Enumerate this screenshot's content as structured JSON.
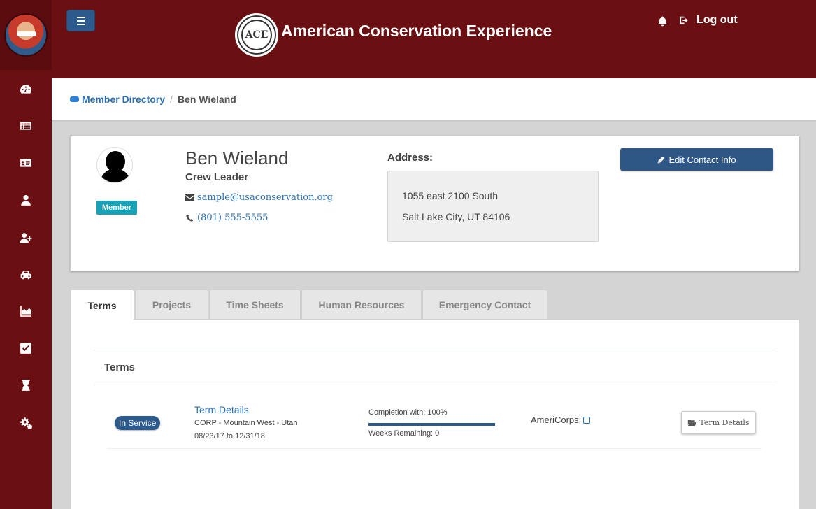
{
  "header": {
    "brand_title": "American Conservation Experience",
    "logo_text": "ACE",
    "logout_label": "Log out"
  },
  "sidebar": {
    "items": [
      {
        "icon": "dashboard-icon"
      },
      {
        "icon": "list-icon"
      },
      {
        "icon": "id-card-icon"
      },
      {
        "icon": "user-icon"
      },
      {
        "icon": "user-plus-icon"
      },
      {
        "icon": "car-icon"
      },
      {
        "icon": "area-chart-icon"
      },
      {
        "icon": "check-square-icon"
      },
      {
        "icon": "hourglass-icon"
      },
      {
        "icon": "cogs-icon"
      }
    ]
  },
  "breadcrumb": {
    "parent": "Member Directory",
    "current": "Ben Wieland"
  },
  "profile": {
    "name": "Ben Wieland",
    "role": "Crew Leader",
    "badge": "Member",
    "email": "sample@usaconservation.org",
    "phone": "(801) 555-5555",
    "address_label": "Address:",
    "address_line1": "1055 east 2100 South",
    "address_line2": "Salt Lake City, UT 84106",
    "edit_label": "Edit Contact Info"
  },
  "tabs": [
    {
      "label": "Terms",
      "active": true
    },
    {
      "label": "Projects",
      "active": false
    },
    {
      "label": "Time Sheets",
      "active": false
    },
    {
      "label": "Human Resources",
      "active": false
    },
    {
      "label": "Emergency Contact",
      "active": false
    }
  ],
  "terms": {
    "title": "Terms",
    "rows": [
      {
        "status": "In Service",
        "link": "Term Details",
        "program": "CORP - Mountain West - Utah",
        "dates": "08/23/17 to 12/31/18",
        "completion_label": "Completion with: 100%",
        "completion_fraction": 1.0,
        "weeks_remaining": "Weeks Remaining: 0",
        "americorps_label": "AmeriCorps:",
        "americorps_checked": false,
        "button_label": "Term Details"
      }
    ]
  },
  "colors": {
    "brand_maroon": "#6b1012",
    "primary_blue": "#2d5a8c",
    "badge_teal": "#17a2b8",
    "link_blue": "#2a6fb3"
  }
}
